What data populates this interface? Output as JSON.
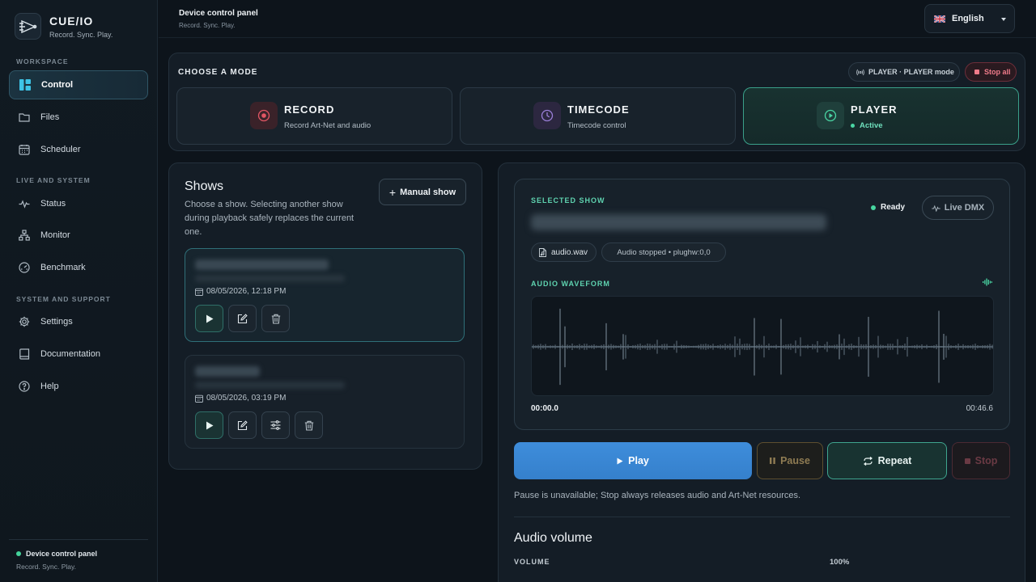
{
  "brand": {
    "title": "CUE/IO",
    "tagline": "Record. Sync. Play."
  },
  "sidebar": {
    "sections": [
      {
        "label": "WORKSPACE"
      },
      {
        "label": "LIVE AND SYSTEM"
      },
      {
        "label": "SYSTEM AND SUPPORT"
      }
    ],
    "items": [
      {
        "label": "Control",
        "icon": "dashboard-icon",
        "active": true
      },
      {
        "label": "Files",
        "icon": "folder-icon"
      },
      {
        "label": "Scheduler",
        "icon": "calendar-icon"
      },
      {
        "label": "Status",
        "icon": "pulse-icon"
      },
      {
        "label": "Monitor",
        "icon": "network-icon"
      },
      {
        "label": "Benchmark",
        "icon": "gauge-icon"
      },
      {
        "label": "Settings",
        "icon": "gear-icon"
      },
      {
        "label": "Documentation",
        "icon": "book-icon"
      },
      {
        "label": "Help",
        "icon": "help-icon"
      }
    ],
    "footer": {
      "title": "Device control panel",
      "subtitle": "Record. Sync. Play."
    }
  },
  "header": {
    "title": "Device control panel",
    "subtitle": "Record. Sync. Play.",
    "language": "English"
  },
  "modes": {
    "heading": "CHOOSE A MODE",
    "status_chip": "PLAYER · PLAYER mode",
    "stop_all": "Stop all",
    "cards": [
      {
        "name": "RECORD",
        "desc": "Record Art-Net and audio",
        "color": "#e25664"
      },
      {
        "name": "TIMECODE",
        "desc": "Timecode control",
        "color": "#9a7fd8"
      },
      {
        "name": "PLAYER",
        "desc": "Active",
        "color": "#4ad6a4",
        "active": true
      }
    ]
  },
  "shows": {
    "title": "Shows",
    "description": "Choose a show. Selecting another show during playback safely replaces the current one.",
    "manual_button": "Manual show",
    "items": [
      {
        "date": "08/05/2026, 12:18 PM",
        "selected": true
      },
      {
        "date": "08/05/2026, 03:19 PM",
        "selected": false
      }
    ]
  },
  "player": {
    "selected_label": "SELECTED SHOW",
    "ready": "Ready",
    "live_dmx": "Live DMX",
    "file": "audio.wav",
    "audio_status": "Audio stopped • plughw:0,0",
    "waveform_label": "AUDIO WAVEFORM",
    "time_start": "00:00.0",
    "time_end": "00:46.6",
    "controls": {
      "play": "Play",
      "pause": "Pause",
      "repeat": "Repeat",
      "stop": "Stop"
    },
    "note": "Pause is unavailable; Stop always releases audio and Art-Net resources.",
    "volume_title": "Audio volume",
    "volume_label": "VOLUME",
    "volume_value": "100%"
  },
  "colors": {
    "accent_teal": "#4ad6a4",
    "accent_blue": "#3a88d6",
    "danger": "#f07b8a"
  }
}
